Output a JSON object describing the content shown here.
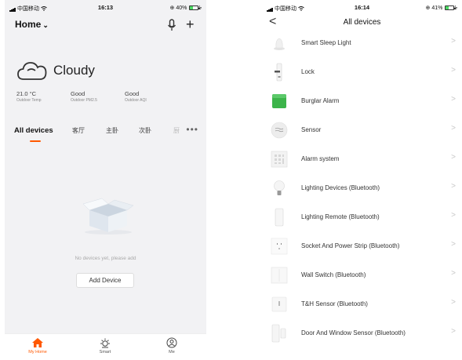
{
  "left_screen": {
    "status": {
      "carrier": "中国移动",
      "time": "16:13",
      "battery": "40%",
      "battery_level": 0.4
    },
    "header": {
      "title": "Home",
      "title_chevron": "⌄",
      "mic_icon": "microphone-icon",
      "add_icon": "plus-icon",
      "add_label": "+"
    },
    "weather": {
      "icon": "cloud-icon",
      "condition": "Cloudy",
      "stats": [
        {
          "value": "21.0 °C",
          "label": "Outdoor Temp"
        },
        {
          "value": "Good",
          "label": "Outdoor PM2.5"
        },
        {
          "value": "Good",
          "label": "Outdoor AQI"
        }
      ]
    },
    "tabs": [
      {
        "label": "All devices",
        "active": true
      },
      {
        "label": "客厅"
      },
      {
        "label": "主卧"
      },
      {
        "label": "次卧"
      },
      {
        "label": "厨"
      }
    ],
    "more_label": "•••",
    "empty": {
      "message": "No devices yet, please add",
      "button": "Add Device"
    },
    "tabbar": [
      {
        "label": "My Home",
        "icon": "home-icon",
        "active": true
      },
      {
        "label": "Smart",
        "icon": "sun-icon"
      },
      {
        "label": "Me",
        "icon": "profile-icon"
      }
    ],
    "accent_color": "#ff5800"
  },
  "right_screen": {
    "status": {
      "carrier": "中国移动",
      "time": "16:14",
      "battery": "41%",
      "battery_level": 0.41
    },
    "nav": {
      "back_label": "<",
      "title": "All devices"
    },
    "arrow_label": ">",
    "devices": [
      {
        "name": "Smart Sleep Light",
        "icon": "sleep-light-icon"
      },
      {
        "name": "Lock",
        "icon": "lock-icon"
      },
      {
        "name": "Burglar Alarm",
        "icon": "burglar-alarm-icon"
      },
      {
        "name": "Sensor",
        "icon": "sensor-icon"
      },
      {
        "name": "Alarm system",
        "icon": "alarm-system-icon"
      },
      {
        "name": "Lighting Devices (Bluetooth)",
        "icon": "bulb-icon"
      },
      {
        "name": "Lighting Remote (Bluetooth)",
        "icon": "remote-icon"
      },
      {
        "name": "Socket And Power Strip (Bluetooth)",
        "icon": "socket-icon"
      },
      {
        "name": "Wall Switch (Bluetooth)",
        "icon": "wall-switch-icon"
      },
      {
        "name": "T&H Sensor (Bluetooth)",
        "icon": "th-sensor-icon"
      },
      {
        "name": "Door And Window Sensor (Bluetooth)",
        "icon": "door-sensor-icon"
      }
    ]
  }
}
